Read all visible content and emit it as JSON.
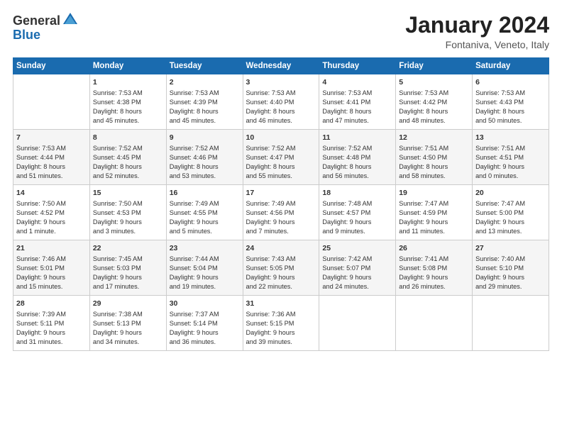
{
  "header": {
    "logo_general": "General",
    "logo_blue": "Blue",
    "title": "January 2024",
    "subtitle": "Fontaniva, Veneto, Italy"
  },
  "columns": [
    "Sunday",
    "Monday",
    "Tuesday",
    "Wednesday",
    "Thursday",
    "Friday",
    "Saturday"
  ],
  "weeks": [
    [
      {
        "day": "",
        "content": ""
      },
      {
        "day": "1",
        "content": "Sunrise: 7:53 AM\nSunset: 4:38 PM\nDaylight: 8 hours\nand 45 minutes."
      },
      {
        "day": "2",
        "content": "Sunrise: 7:53 AM\nSunset: 4:39 PM\nDaylight: 8 hours\nand 45 minutes."
      },
      {
        "day": "3",
        "content": "Sunrise: 7:53 AM\nSunset: 4:40 PM\nDaylight: 8 hours\nand 46 minutes."
      },
      {
        "day": "4",
        "content": "Sunrise: 7:53 AM\nSunset: 4:41 PM\nDaylight: 8 hours\nand 47 minutes."
      },
      {
        "day": "5",
        "content": "Sunrise: 7:53 AM\nSunset: 4:42 PM\nDaylight: 8 hours\nand 48 minutes."
      },
      {
        "day": "6",
        "content": "Sunrise: 7:53 AM\nSunset: 4:43 PM\nDaylight: 8 hours\nand 50 minutes."
      }
    ],
    [
      {
        "day": "7",
        "content": "Sunrise: 7:53 AM\nSunset: 4:44 PM\nDaylight: 8 hours\nand 51 minutes."
      },
      {
        "day": "8",
        "content": "Sunrise: 7:52 AM\nSunset: 4:45 PM\nDaylight: 8 hours\nand 52 minutes."
      },
      {
        "day": "9",
        "content": "Sunrise: 7:52 AM\nSunset: 4:46 PM\nDaylight: 8 hours\nand 53 minutes."
      },
      {
        "day": "10",
        "content": "Sunrise: 7:52 AM\nSunset: 4:47 PM\nDaylight: 8 hours\nand 55 minutes."
      },
      {
        "day": "11",
        "content": "Sunrise: 7:52 AM\nSunset: 4:48 PM\nDaylight: 8 hours\nand 56 minutes."
      },
      {
        "day": "12",
        "content": "Sunrise: 7:51 AM\nSunset: 4:50 PM\nDaylight: 8 hours\nand 58 minutes."
      },
      {
        "day": "13",
        "content": "Sunrise: 7:51 AM\nSunset: 4:51 PM\nDaylight: 9 hours\nand 0 minutes."
      }
    ],
    [
      {
        "day": "14",
        "content": "Sunrise: 7:50 AM\nSunset: 4:52 PM\nDaylight: 9 hours\nand 1 minute."
      },
      {
        "day": "15",
        "content": "Sunrise: 7:50 AM\nSunset: 4:53 PM\nDaylight: 9 hours\nand 3 minutes."
      },
      {
        "day": "16",
        "content": "Sunrise: 7:49 AM\nSunset: 4:55 PM\nDaylight: 9 hours\nand 5 minutes."
      },
      {
        "day": "17",
        "content": "Sunrise: 7:49 AM\nSunset: 4:56 PM\nDaylight: 9 hours\nand 7 minutes."
      },
      {
        "day": "18",
        "content": "Sunrise: 7:48 AM\nSunset: 4:57 PM\nDaylight: 9 hours\nand 9 minutes."
      },
      {
        "day": "19",
        "content": "Sunrise: 7:47 AM\nSunset: 4:59 PM\nDaylight: 9 hours\nand 11 minutes."
      },
      {
        "day": "20",
        "content": "Sunrise: 7:47 AM\nSunset: 5:00 PM\nDaylight: 9 hours\nand 13 minutes."
      }
    ],
    [
      {
        "day": "21",
        "content": "Sunrise: 7:46 AM\nSunset: 5:01 PM\nDaylight: 9 hours\nand 15 minutes."
      },
      {
        "day": "22",
        "content": "Sunrise: 7:45 AM\nSunset: 5:03 PM\nDaylight: 9 hours\nand 17 minutes."
      },
      {
        "day": "23",
        "content": "Sunrise: 7:44 AM\nSunset: 5:04 PM\nDaylight: 9 hours\nand 19 minutes."
      },
      {
        "day": "24",
        "content": "Sunrise: 7:43 AM\nSunset: 5:05 PM\nDaylight: 9 hours\nand 22 minutes."
      },
      {
        "day": "25",
        "content": "Sunrise: 7:42 AM\nSunset: 5:07 PM\nDaylight: 9 hours\nand 24 minutes."
      },
      {
        "day": "26",
        "content": "Sunrise: 7:41 AM\nSunset: 5:08 PM\nDaylight: 9 hours\nand 26 minutes."
      },
      {
        "day": "27",
        "content": "Sunrise: 7:40 AM\nSunset: 5:10 PM\nDaylight: 9 hours\nand 29 minutes."
      }
    ],
    [
      {
        "day": "28",
        "content": "Sunrise: 7:39 AM\nSunset: 5:11 PM\nDaylight: 9 hours\nand 31 minutes."
      },
      {
        "day": "29",
        "content": "Sunrise: 7:38 AM\nSunset: 5:13 PM\nDaylight: 9 hours\nand 34 minutes."
      },
      {
        "day": "30",
        "content": "Sunrise: 7:37 AM\nSunset: 5:14 PM\nDaylight: 9 hours\nand 36 minutes."
      },
      {
        "day": "31",
        "content": "Sunrise: 7:36 AM\nSunset: 5:15 PM\nDaylight: 9 hours\nand 39 minutes."
      },
      {
        "day": "",
        "content": ""
      },
      {
        "day": "",
        "content": ""
      },
      {
        "day": "",
        "content": ""
      }
    ]
  ]
}
